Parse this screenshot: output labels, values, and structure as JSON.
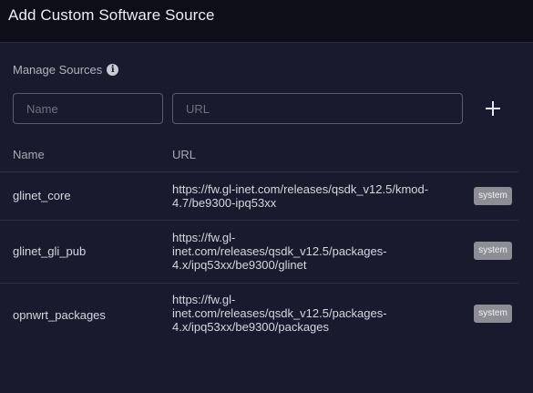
{
  "dialog": {
    "title": "Add Custom Software Source"
  },
  "manage": {
    "label": "Manage Sources",
    "info_icon": "info-icon"
  },
  "form": {
    "name_placeholder": "Name",
    "url_placeholder": "URL",
    "add_icon": "plus-icon"
  },
  "table": {
    "headers": {
      "name": "Name",
      "url": "URL"
    },
    "rows": [
      {
        "name": "glinet_core",
        "url_lines": [
          "https://fw.gl-inet.com/releases/qsdk_v12.5/kmod-",
          "4.7/be9300-ipq53xx"
        ],
        "badge": "system"
      },
      {
        "name": "glinet_gli_pub",
        "url_lines": [
          "https://fw.gl-",
          "inet.com/releases/qsdk_v12.5/packages-",
          "4.x/ipq53xx/be9300/glinet"
        ],
        "badge": "system"
      },
      {
        "name": "opnwrt_packages",
        "url_lines": [
          "https://fw.gl-",
          "inet.com/releases/qsdk_v12.5/packages-",
          "4.x/ipq53xx/be9300/packages"
        ],
        "badge": "system"
      }
    ]
  }
}
